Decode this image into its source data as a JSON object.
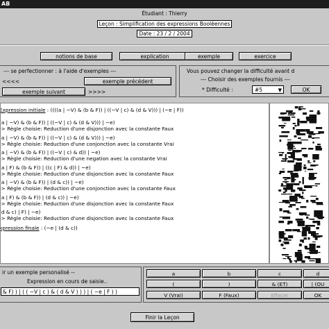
{
  "window": {
    "title": "AB"
  },
  "header": {
    "student": "Étudiant : Thierry",
    "lesson": "Leçon : Simplification des expressions Booléennes",
    "date": "Date : 23 / 2 / 2004"
  },
  "nav": {
    "tabs": [
      "notions de base",
      "explication",
      "exemple",
      "exercice"
    ]
  },
  "practice": {
    "title": "--- se perfectionner :    à l'aide d'exemples ---",
    "arrows_left": "<<<<",
    "prev_label": "exemple précédent",
    "next_label": "exemple suivant",
    "arrows_right": ">>>>"
  },
  "difficulty": {
    "info": "Vous pouvez changer la difficulté avant d",
    "choose": "--- Choisir des exemples fournis ---",
    "label": "* Difficulté :",
    "value": "#5",
    "ok_label": "OK"
  },
  "solution": {
    "initial": {
      "label": "Expression initiale",
      "sep": " :  ",
      "value": "((((a | ~V) & (b & F)) | ((~V | c) & (d & V))) | (~e | F))"
    },
    "steps": [
      {
        "expr": "(a | ~V) & (b & F)) | ((~V | c) & (d & V))) | ~e)",
        "rule": "-> Règle choisie: Reduction d'une disjonction avec la constante Faux"
      },
      {
        "expr": "(a | ~V) & (b & F)) | ((~V | c) & (d & V))) | ~e)",
        "rule": "-> Règle choisie: Reduction d'une conjonction avec la constante Vrai"
      },
      {
        "expr": "(a | ~V) & (b & F)) | ((~V | c) & d)) | ~e)",
        "rule": "-> Règle choisie: Reduction d'une negation avec la constante Vrai"
      },
      {
        "expr": "(a | F) & (b & F)) | ((c | F) & d)) | ~e)",
        "rule": "-> Règle choisie: Reduction d'une disjonction avec la constante Faux"
      },
      {
        "expr": "(a | ~V) & (b & F)) | (d & c)) | ~e)",
        "rule": "-> Règle choisie: Reduction d'une conjonction avec la constante Faux"
      },
      {
        "expr": "(a | F) & (b & F)) | (d & c)) | ~e)",
        "rule": "-> Règle choisie: Reduction d'une disjonction avec la constante Faux"
      },
      {
        "expr": "(d & c) | F) | ~e)",
        "rule": "-> Règle choisie: Reduction d'une disjonction avec la constante Faux"
      }
    ],
    "final": {
      "label": "xpression finale",
      "sep": " :  ",
      "value": "(~e | (d & c))"
    }
  },
  "custom": {
    "title": "ir un exemple personalisé --",
    "expr_label": "Expression en cours de saisie..",
    "expr_value": "& F) ) | ( ( ~V | c ) & ( d & V ) ) ) | ( ~e | F ) )"
  },
  "keypad": {
    "row1": [
      "a",
      "b",
      "c",
      "d"
    ],
    "row2": [
      "(",
      ")",
      "& (ET)",
      "| (OU"
    ],
    "row3": [
      "V (Vrai)",
      "F (Faux)",
      "Effacer",
      "OK"
    ]
  },
  "footer": {
    "finish_label": "Finir la Leçon"
  },
  "colors": {
    "titlebar": "#1c1c1c",
    "panel": "#c8c8c8",
    "disabled_text": "#9a9a9a"
  }
}
